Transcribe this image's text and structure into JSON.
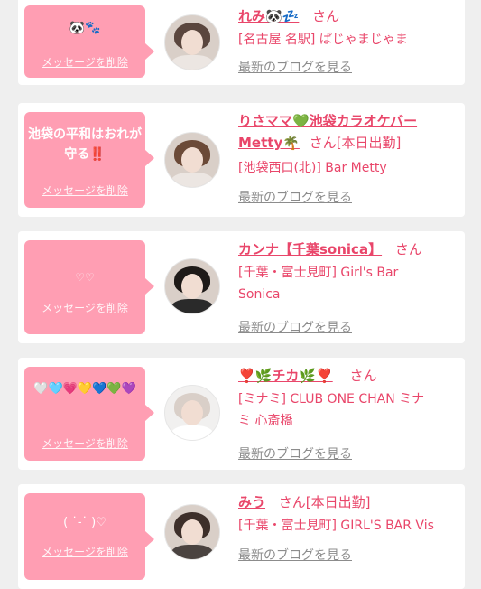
{
  "items": [
    {
      "bubble_message": "🐼🐾",
      "delete_label": "メッセージを削除",
      "name": "れみ🐼💤",
      "name_suffix": "さん",
      "shop_line1": "[名古屋 名駅] ぱじゃまじゃま",
      "shop_line2": "",
      "blog_label": "最新のブログを見る",
      "avatar_colors": {
        "bg": "#cfc3bd",
        "hair": "#5a463e",
        "face": "#f2dfd5",
        "body": "#e8e3df"
      }
    },
    {
      "bubble_message": "池袋の平和はおれが守る‼️",
      "delete_label": "メッセージを削除",
      "name": "りさママ💚池袋カラオケバーMetty🌴",
      "name_suffix": "さん[本日出勤]",
      "shop_line1": "[池袋西口(北)] Bar Metty",
      "shop_line2": "",
      "blog_label": "最新のブログを見る",
      "avatar_colors": {
        "bg": "#d8c2b4",
        "hair": "#6b4a38",
        "face": "#f3e0d4",
        "body": "#f2ece8"
      }
    },
    {
      "bubble_message": "♡♡",
      "delete_label": "メッセージを削除",
      "name": "カンナ【千葉sonica】",
      "name_suffix": "さん",
      "shop_line1": "[千葉・富士見町] Girl's Bar",
      "shop_line2": "Sonica",
      "blog_label": "最新のブログを見る",
      "avatar_colors": {
        "bg": "#bfbab4",
        "hair": "#1e1a18",
        "face": "#f0dcd2",
        "body": "#2a2a2a"
      }
    },
    {
      "bubble_message": "🤍🩵💗💛💙💚💜",
      "delete_label": "メッセージを削除",
      "name": "❣️🌿チカ🌿❣️",
      "name_suffix": "さん",
      "shop_line1": "[ミナミ] CLUB ONE CHAN ミナ",
      "shop_line2": "ミ 心斎橋",
      "blog_label": "最新のブログを見る",
      "avatar_colors": {
        "bg": "#f1f0ef",
        "hair": "#d9cfc8",
        "face": "#f4e6de",
        "body": "#ffffff"
      }
    },
    {
      "bubble_message": "( ˙-˙ )♡",
      "delete_label": "メッセージを削除",
      "name": "みう",
      "name_suffix": "さん[本日出勤]",
      "shop_line1": "[千葉・富士見町] GIRL'S BAR Vis",
      "shop_line2": "",
      "blog_label": "最新のブログを見る",
      "avatar_colors": {
        "bg": "#b9a59a",
        "hair": "#3d2f2a",
        "face": "#efdad0",
        "body": "#4a4340"
      }
    }
  ],
  "colors": {
    "accent": "#e9466a",
    "bubble": "#ff9eb3",
    "link_gray": "#8c8c8c"
  }
}
